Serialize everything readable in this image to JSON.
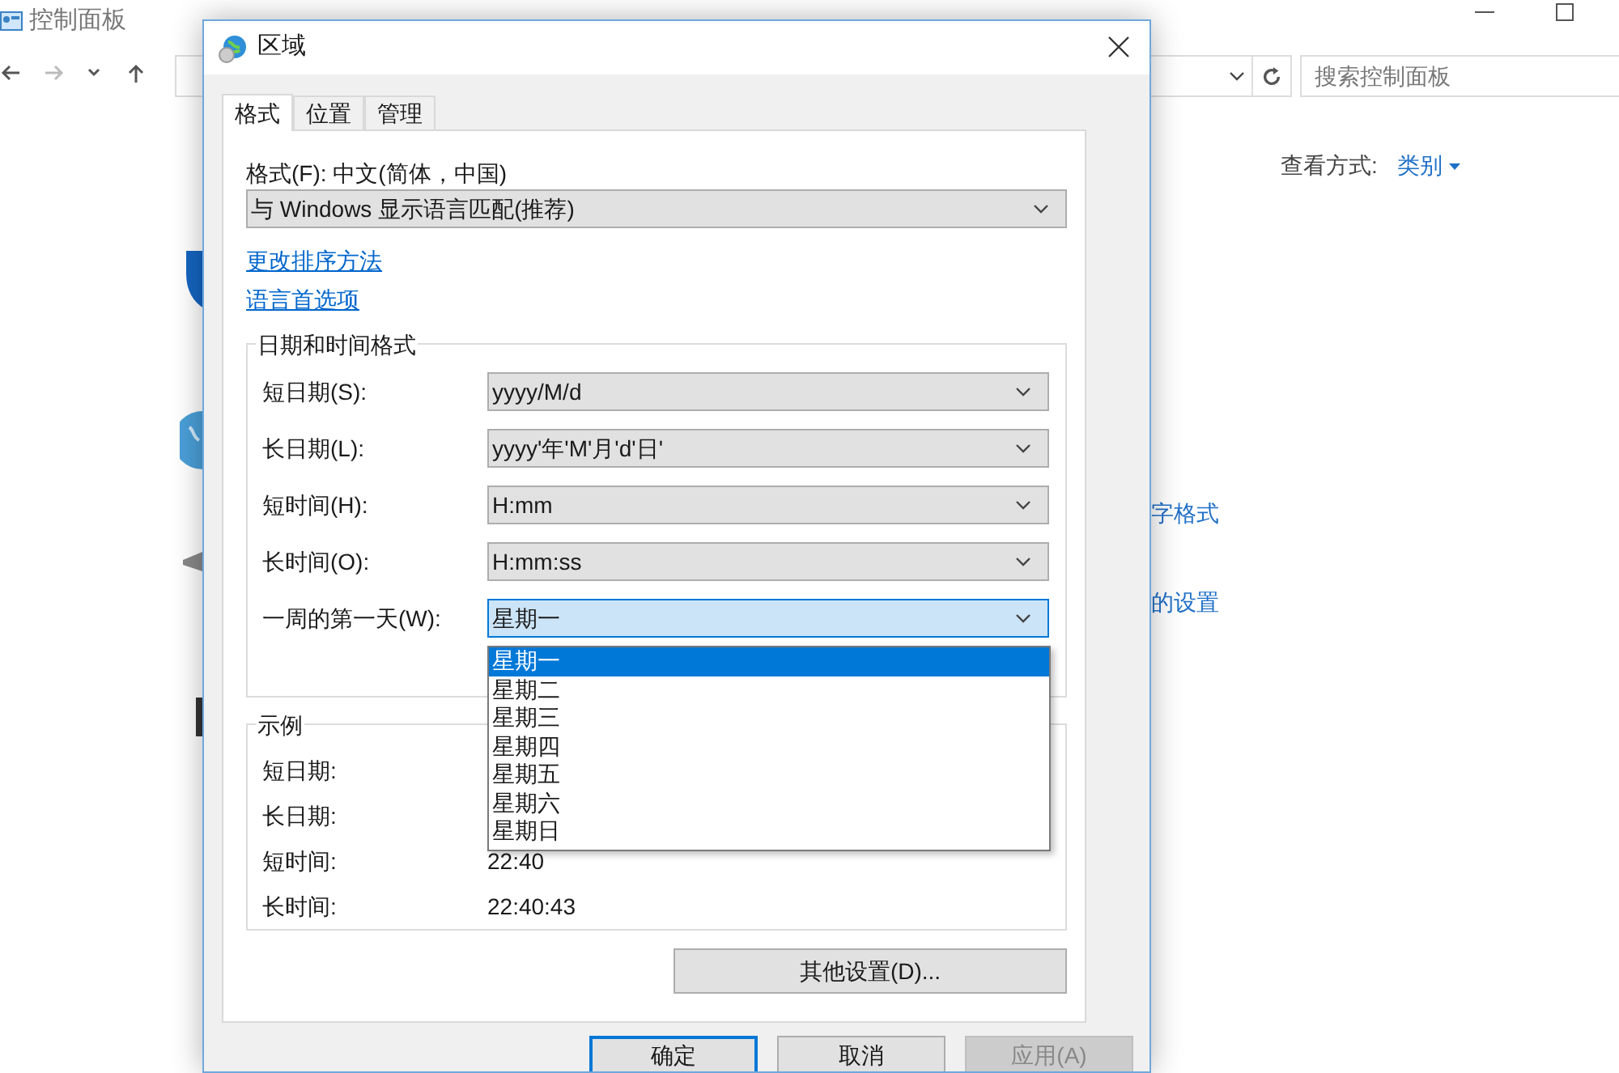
{
  "background_window": {
    "title": "控制面板",
    "search": {
      "placeholder": "搜索控制面板"
    },
    "view_by_label": "查看方式:",
    "view_by_value": "类别",
    "links": [
      "字格式",
      "的设置"
    ]
  },
  "dialog": {
    "title": "区域",
    "tabs": [
      {
        "label": "格式",
        "selected": true
      },
      {
        "label": "位置",
        "selected": false
      },
      {
        "label": "管理",
        "selected": false
      }
    ],
    "format_label": "格式(F): 中文(简体，中国)",
    "format_value": "与 Windows 显示语言匹配(推荐)",
    "links": [
      "更改排序方法",
      "语言首选项"
    ],
    "date_time_group": {
      "title": "日期和时间格式",
      "rows": [
        {
          "label": "短日期(S):",
          "value": "yyyy/M/d",
          "focused": false
        },
        {
          "label": "长日期(L):",
          "value": "yyyy'年'M'月'd'日'",
          "focused": false
        },
        {
          "label": "短时间(H):",
          "value": "H:mm",
          "focused": false
        },
        {
          "label": "长时间(O):",
          "value": "H:mm:ss",
          "focused": false
        },
        {
          "label": "一周的第一天(W):",
          "value": "星期一",
          "focused": true
        }
      ]
    },
    "dropdown": {
      "items": [
        {
          "label": "星期一",
          "selected": true
        },
        {
          "label": "星期二",
          "selected": false
        },
        {
          "label": "星期三",
          "selected": false
        },
        {
          "label": "星期四",
          "selected": false
        },
        {
          "label": "星期五",
          "selected": false
        },
        {
          "label": "星期六",
          "selected": false
        },
        {
          "label": "星期日",
          "selected": false
        }
      ]
    },
    "examples": {
      "title": "示例",
      "rows": [
        {
          "label": "短日期:"
        },
        {
          "label": "长日期:"
        },
        {
          "label": "短时间:",
          "value": "22:40"
        },
        {
          "label": "长时间:",
          "value": "22:40:43"
        }
      ]
    },
    "additional_button": "其他设置(D)...",
    "buttons": [
      {
        "label": "确定",
        "default": true,
        "disabled": false
      },
      {
        "label": "取消",
        "default": false,
        "disabled": false
      },
      {
        "label": "应用(A)",
        "default": false,
        "disabled": true
      }
    ]
  }
}
